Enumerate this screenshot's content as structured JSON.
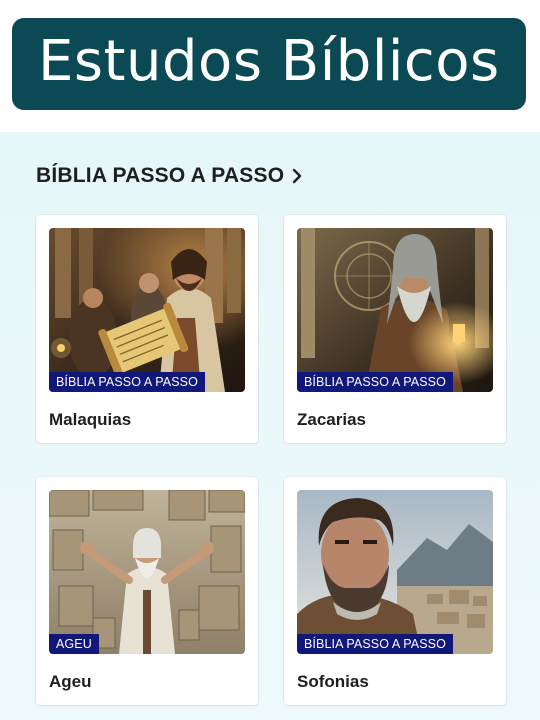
{
  "header": {
    "title": "Estudos Bíblicos",
    "banner_color": "#0b4a55"
  },
  "section": {
    "title": "BÍBLIA PASSO A PASSO",
    "chevron_icon": "chevron-right-icon"
  },
  "cards": [
    {
      "title": "Malaquias",
      "tag": "BÍBLIA PASSO A PASSO"
    },
    {
      "title": "Zacarias",
      "tag": "BÍBLIA PASSO A PASSO"
    },
    {
      "title": "Ageu",
      "tag": "AGEU"
    },
    {
      "title": "Sofonias",
      "tag": "BÍBLIA PASSO A PASSO"
    }
  ],
  "colors": {
    "tag_background": "#12177a",
    "content_background": "#e9f8fa"
  }
}
